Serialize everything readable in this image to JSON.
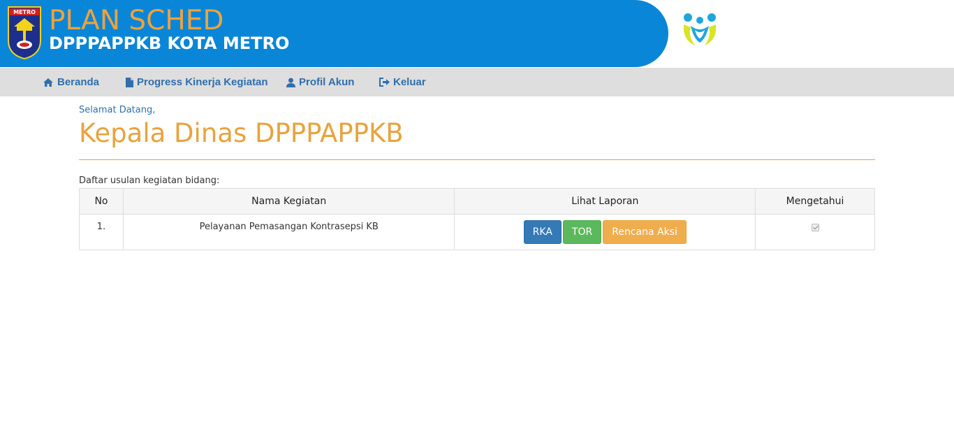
{
  "header": {
    "title": "PLAN SCHED",
    "subtitle": "DPPPAPPKB KOTA METRO",
    "emblem_text": "METRO"
  },
  "nav": {
    "items": [
      {
        "label": "Beranda",
        "icon": "home-icon"
      },
      {
        "label": "Progress Kinerja Kegiatan",
        "icon": "file-icon"
      },
      {
        "label": "Profil Akun",
        "icon": "user-icon"
      },
      {
        "label": "Keluar",
        "icon": "sign-out-icon"
      }
    ]
  },
  "main": {
    "welcome": "Selamat Datang,",
    "user_name": "Kepala Dinas DPPPAPPKB",
    "list_caption": "Daftar usulan kegiatan bidang:"
  },
  "table": {
    "headers": [
      "No",
      "Nama Kegiatan",
      "Lihat Laporan",
      "Mengetahui"
    ],
    "rows": [
      {
        "no": "1.",
        "nama": "Pelayanan Pemasangan Kontrasepsi KB",
        "buttons": [
          "RKA",
          "TOR",
          "Rencana Aksi"
        ],
        "mengetahui": true
      }
    ]
  },
  "colors": {
    "header_blue": "#0a86d8",
    "title_orange": "#f0a23a",
    "nav_bg": "#dedede",
    "nav_link": "#2f6fae",
    "btn_primary": "#337ab7",
    "btn_success": "#5cb85c",
    "btn_warning": "#f0ad4e"
  }
}
